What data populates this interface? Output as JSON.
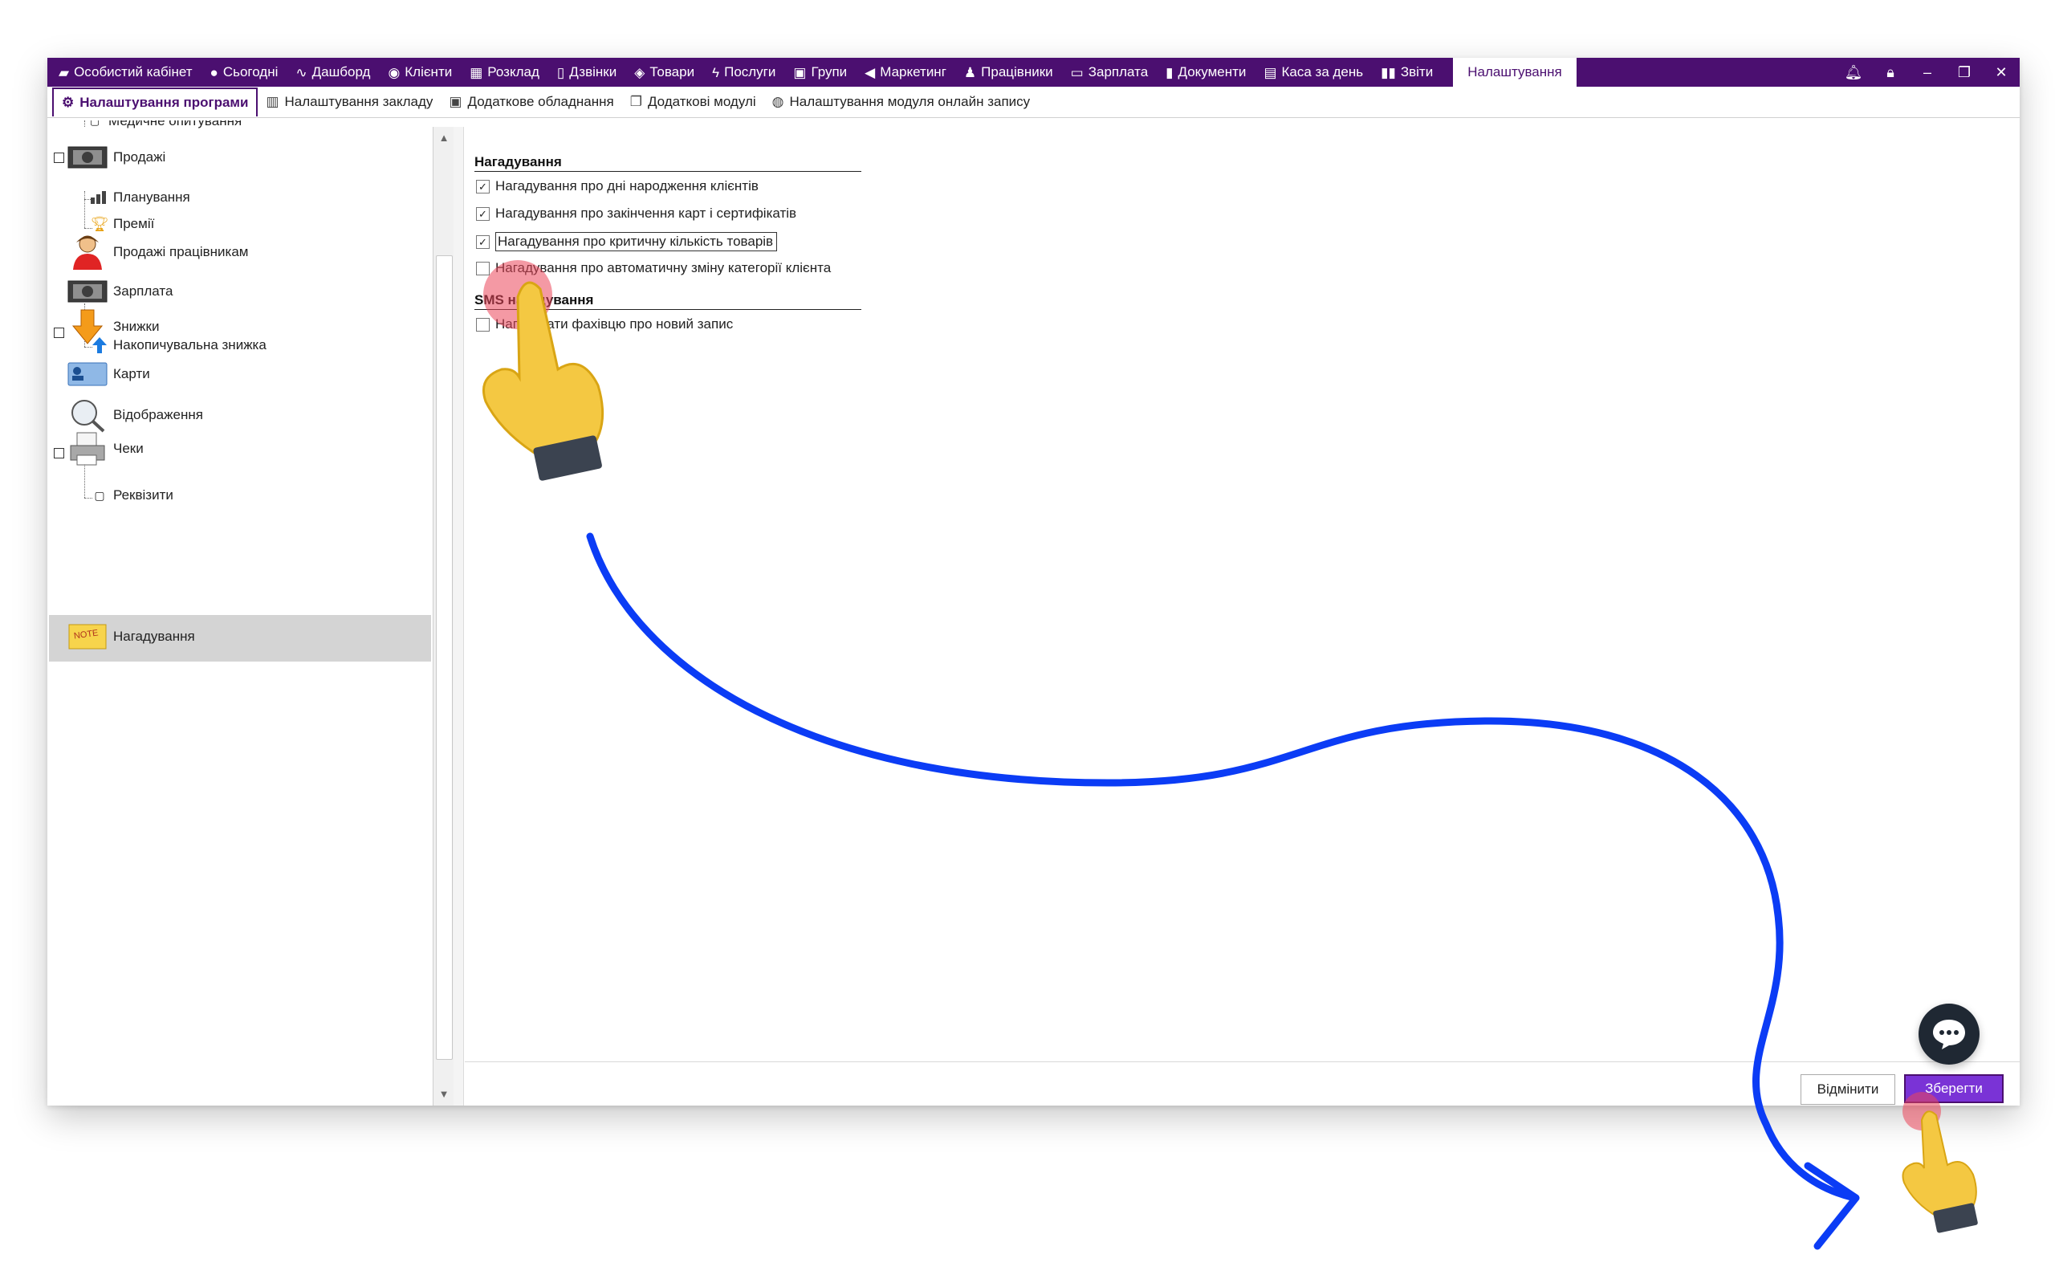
{
  "topnav": {
    "items": [
      {
        "label": "Особистий кабінет",
        "icon": "briefcase-icon"
      },
      {
        "label": "Сьогодні",
        "icon": "clock-icon"
      },
      {
        "label": "Дашборд",
        "icon": "pulse-icon"
      },
      {
        "label": "Клієнти",
        "icon": "user-circle-icon"
      },
      {
        "label": "Розклад",
        "icon": "calendar-icon"
      },
      {
        "label": "Дзвінки",
        "icon": "phone-icon"
      },
      {
        "label": "Товари",
        "icon": "box-icon"
      },
      {
        "label": "Послуги",
        "icon": "lightning-icon"
      },
      {
        "label": "Групи",
        "icon": "group-icon"
      },
      {
        "label": "Маркетинг",
        "icon": "megaphone-icon"
      },
      {
        "label": "Працівники",
        "icon": "person-icon"
      },
      {
        "label": "Зарплата",
        "icon": "money-icon"
      },
      {
        "label": "Документи",
        "icon": "document-icon"
      },
      {
        "label": "Каса за день",
        "icon": "calculator-icon"
      },
      {
        "label": "Звіти",
        "icon": "bar-chart-icon"
      }
    ],
    "active": "Налаштування",
    "window": {
      "bell": "bell-icon",
      "lock": "lock-icon",
      "minimize": "minimize-icon",
      "restore": "restore-icon",
      "close": "close-icon"
    }
  },
  "subtabs": {
    "items": [
      {
        "label": "Налаштування програми",
        "icon": "gear-icon"
      },
      {
        "label": "Налаштування закладу",
        "icon": "building-icon"
      },
      {
        "label": "Додаткове обладнання",
        "icon": "printer-icon"
      },
      {
        "label": "Додаткові модулі",
        "icon": "modules-icon"
      },
      {
        "label": "Налаштування модуля онлайн запису",
        "icon": "globe-icon"
      }
    ]
  },
  "tree": {
    "items": [
      {
        "label": "Медичне опитування"
      },
      {
        "label": "Продажі"
      },
      {
        "label": "Планування"
      },
      {
        "label": "Премії"
      },
      {
        "label": "Продажі працівникам"
      },
      {
        "label": "Зарплата"
      },
      {
        "label": "Знижки"
      },
      {
        "label": "Накопичувальна знижка"
      },
      {
        "label": "Карти"
      },
      {
        "label": "Відображення"
      },
      {
        "label": "Чеки"
      },
      {
        "label": "Реквізити"
      },
      {
        "label": "Нагадування"
      }
    ],
    "selected": "Нагадування"
  },
  "content": {
    "section1": {
      "title": "Нагадування",
      "options": [
        {
          "label": "Нагадування про дні народження клієнтів",
          "checked": true
        },
        {
          "label": "Нагадування про закінчення карт і сертифікатів",
          "checked": true
        },
        {
          "label": "Нагадування про критичну кількість товарів",
          "checked": true
        },
        {
          "label": "Нагадування про автоматичну зміну категорії клієнта",
          "checked": false
        }
      ]
    },
    "section2": {
      "title": "SMS нагадування",
      "options": [
        {
          "label": "Нагадувати фахівцю про новий запис",
          "checked": false
        }
      ]
    }
  },
  "buttons": {
    "cancel": "Відмінити",
    "save": "Зберегти"
  },
  "colors": {
    "brand": "#4b0f70",
    "save": "#7a33d6",
    "arrow": "#0b3cf5",
    "hand": "#f4c842"
  }
}
